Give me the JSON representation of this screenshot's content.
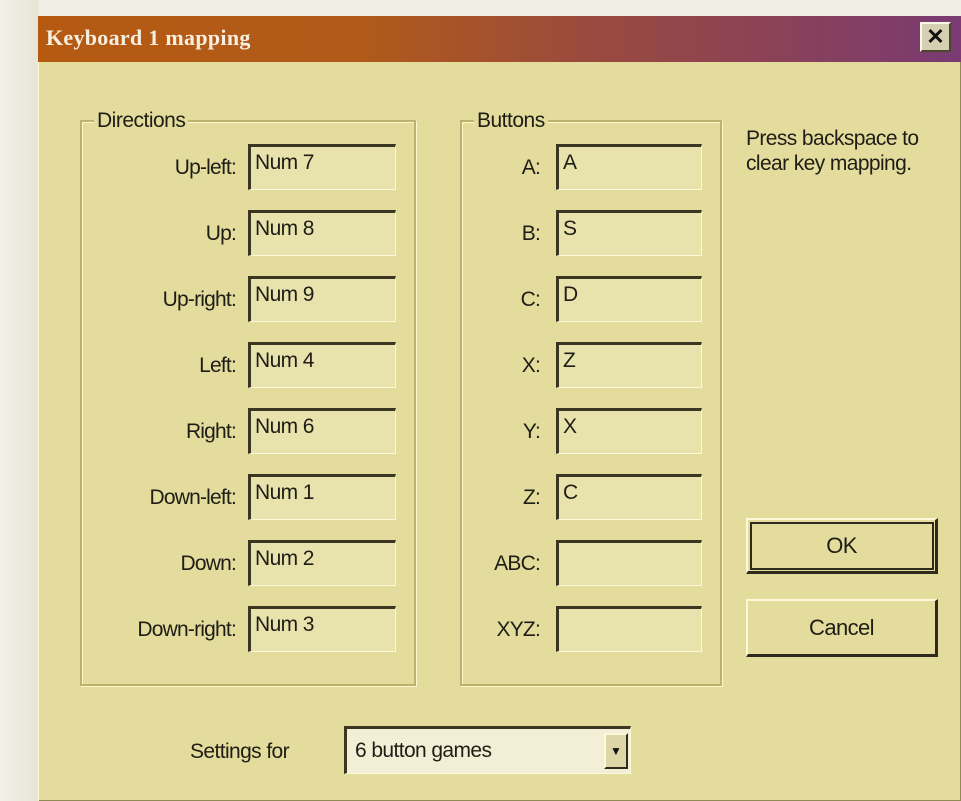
{
  "window": {
    "title": "Keyboard 1 mapping",
    "close_glyph": "✕"
  },
  "directions": {
    "label": "Directions",
    "rows": [
      {
        "label": "Up-left:",
        "value": "Num 7"
      },
      {
        "label": "Up:",
        "value": "Num 8"
      },
      {
        "label": "Up-right:",
        "value": "Num 9"
      },
      {
        "label": "Left:",
        "value": "Num 4"
      },
      {
        "label": "Right:",
        "value": "Num 6"
      },
      {
        "label": "Down-left:",
        "value": "Num 1"
      },
      {
        "label": "Down:",
        "value": "Num 2"
      },
      {
        "label": "Down-right:",
        "value": "Num 3"
      }
    ]
  },
  "buttons": {
    "label": "Buttons",
    "rows": [
      {
        "label": "A:",
        "value": "A"
      },
      {
        "label": "B:",
        "value": "S"
      },
      {
        "label": "C:",
        "value": "D"
      },
      {
        "label": "X:",
        "value": "Z"
      },
      {
        "label": "Y:",
        "value": "X"
      },
      {
        "label": "Z:",
        "value": "C"
      },
      {
        "label": "ABC:",
        "value": ""
      },
      {
        "label": "XYZ:",
        "value": ""
      }
    ]
  },
  "note": "Press backspace to clear key mapping.",
  "ok_label": "OK",
  "cancel_label": "Cancel",
  "settings": {
    "label": "Settings for",
    "selected": "6 button games"
  },
  "colors": {
    "dialog_bg": "#e3dc9c",
    "title_gradient_start": "#b65a12",
    "title_gradient_end": "#7a3a73"
  }
}
